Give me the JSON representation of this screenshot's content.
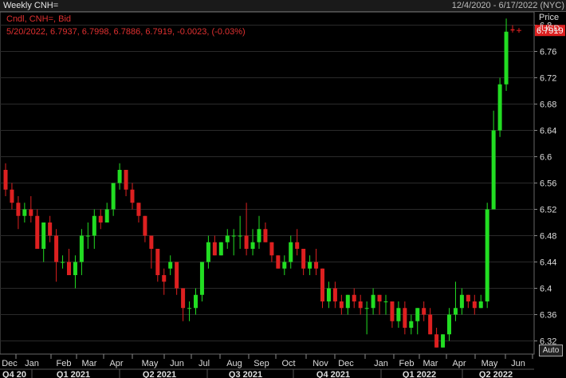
{
  "header": {
    "title": "Weekly CNH=",
    "date_range": "12/4/2020 - 6/17/2022 (NYC)"
  },
  "legend": {
    "line1": "Cndl, CNH=, Bid",
    "line2": "5/20/2022, 6.7937, 6.7998, 6.7886, 6.7919, -0.0023, (-0.03%)"
  },
  "axis": {
    "price_label_1": "Price",
    "price_label_2": "/USD",
    "last_price": "6.7919",
    "yticks": [
      6.32,
      6.36,
      6.4,
      6.44,
      6.48,
      6.52,
      6.56,
      6.6,
      6.64,
      6.68,
      6.72,
      6.76,
      6.8
    ],
    "months": [
      "Dec",
      "Jan",
      "Feb",
      "Mar",
      "Apr",
      "May",
      "Jun",
      "Jul",
      "Aug",
      "Sep",
      "Oct",
      "Nov",
      "Dec",
      "Jan",
      "Feb",
      "Mar",
      "Apr",
      "May",
      "Jun"
    ],
    "quarters": [
      "Q4 20",
      "Q1 2021",
      "Q2 2021",
      "Q3 2021",
      "Q4 2021",
      "Q1 2022",
      "Q2 2022"
    ]
  },
  "auto_label": "Auto",
  "colors": {
    "up": "#22dd22",
    "down": "#dd2020",
    "legend_text": "#e03030",
    "background": "#000000",
    "grid": "#2a2a2a"
  },
  "chart_data": {
    "type": "candlestick",
    "title": "Weekly CNH=",
    "ylabel": "Price /USD",
    "ylim": [
      6.3,
      6.82
    ],
    "x_start": "2020-12-04",
    "interval": "weekly",
    "last_close": 6.7919,
    "ohlc": [
      [
        6.58,
        6.59,
        6.54,
        6.55
      ],
      [
        6.55,
        6.56,
        6.52,
        6.53
      ],
      [
        6.53,
        6.54,
        6.49,
        6.51
      ],
      [
        6.51,
        6.53,
        6.5,
        6.52
      ],
      [
        6.52,
        6.54,
        6.5,
        6.51
      ],
      [
        6.51,
        6.52,
        6.46,
        6.46
      ],
      [
        6.46,
        6.5,
        6.44,
        6.5
      ],
      [
        6.5,
        6.51,
        6.47,
        6.48
      ],
      [
        6.48,
        6.49,
        6.41,
        6.44
      ],
      [
        6.44,
        6.45,
        6.43,
        6.44
      ],
      [
        6.44,
        6.46,
        6.42,
        6.42
      ],
      [
        6.42,
        6.45,
        6.4,
        6.44
      ],
      [
        6.44,
        6.49,
        6.42,
        6.48
      ],
      [
        6.48,
        6.5,
        6.46,
        6.48
      ],
      [
        6.48,
        6.52,
        6.46,
        6.51
      ],
      [
        6.51,
        6.52,
        6.49,
        6.5
      ],
      [
        6.5,
        6.53,
        6.5,
        6.52
      ],
      [
        6.52,
        6.56,
        6.51,
        6.56
      ],
      [
        6.56,
        6.59,
        6.55,
        6.58
      ],
      [
        6.58,
        6.58,
        6.54,
        6.55
      ],
      [
        6.55,
        6.56,
        6.52,
        6.53
      ],
      [
        6.53,
        6.53,
        6.5,
        6.51
      ],
      [
        6.51,
        6.51,
        6.47,
        6.48
      ],
      [
        6.48,
        6.48,
        6.43,
        6.46
      ],
      [
        6.46,
        6.46,
        6.41,
        6.42
      ],
      [
        6.42,
        6.43,
        6.39,
        6.41
      ],
      [
        6.43,
        6.45,
        6.42,
        6.44
      ],
      [
        6.44,
        6.44,
        6.39,
        6.4
      ],
      [
        6.4,
        6.4,
        6.35,
        6.37
      ],
      [
        6.37,
        6.38,
        6.35,
        6.37
      ],
      [
        6.37,
        6.4,
        6.36,
        6.39
      ],
      [
        6.39,
        6.44,
        6.38,
        6.44
      ],
      [
        6.44,
        6.48,
        6.43,
        6.47
      ],
      [
        6.47,
        6.48,
        6.45,
        6.45
      ],
      [
        6.45,
        6.47,
        6.45,
        6.47
      ],
      [
        6.47,
        6.49,
        6.46,
        6.48
      ],
      [
        6.48,
        6.49,
        6.45,
        6.48
      ],
      [
        6.48,
        6.51,
        6.46,
        6.48
      ],
      [
        6.48,
        6.53,
        6.45,
        6.46
      ],
      [
        6.46,
        6.49,
        6.45,
        6.47
      ],
      [
        6.47,
        6.51,
        6.46,
        6.49
      ],
      [
        6.49,
        6.5,
        6.47,
        6.47
      ],
      [
        6.47,
        6.47,
        6.44,
        6.45
      ],
      [
        6.45,
        6.45,
        6.43,
        6.43
      ],
      [
        6.43,
        6.45,
        6.42,
        6.44
      ],
      [
        6.44,
        6.48,
        6.43,
        6.47
      ],
      [
        6.47,
        6.49,
        6.45,
        6.46
      ],
      [
        6.46,
        6.46,
        6.42,
        6.43
      ],
      [
        6.43,
        6.45,
        6.42,
        6.44
      ],
      [
        6.44,
        6.46,
        6.42,
        6.43
      ],
      [
        6.43,
        6.43,
        6.37,
        6.38
      ],
      [
        6.38,
        6.41,
        6.37,
        6.4
      ],
      [
        6.4,
        6.41,
        6.37,
        6.38
      ],
      [
        6.38,
        6.39,
        6.36,
        6.37
      ],
      [
        6.37,
        6.39,
        6.36,
        6.39
      ],
      [
        6.39,
        6.4,
        6.37,
        6.38
      ],
      [
        6.38,
        6.39,
        6.36,
        6.37
      ],
      [
        6.37,
        6.38,
        6.33,
        6.37
      ],
      [
        6.37,
        6.4,
        6.36,
        6.39
      ],
      [
        6.39,
        6.39,
        6.36,
        6.38
      ],
      [
        6.38,
        6.39,
        6.36,
        6.38
      ],
      [
        6.38,
        6.38,
        6.34,
        6.35
      ],
      [
        6.35,
        6.38,
        6.34,
        6.37
      ],
      [
        6.37,
        6.38,
        6.33,
        6.34
      ],
      [
        6.34,
        6.36,
        6.33,
        6.35
      ],
      [
        6.35,
        6.37,
        6.33,
        6.37
      ],
      [
        6.37,
        6.38,
        6.35,
        6.36
      ],
      [
        6.36,
        6.37,
        6.33,
        6.33
      ],
      [
        6.33,
        6.34,
        6.31,
        6.31
      ],
      [
        6.31,
        6.33,
        6.31,
        6.33
      ],
      [
        6.33,
        6.37,
        6.32,
        6.36
      ],
      [
        6.36,
        6.41,
        6.35,
        6.37
      ],
      [
        6.37,
        6.4,
        6.36,
        6.39
      ],
      [
        6.39,
        6.39,
        6.37,
        6.38
      ],
      [
        6.38,
        6.39,
        6.36,
        6.37
      ],
      [
        6.37,
        6.39,
        6.37,
        6.38
      ],
      [
        6.38,
        6.53,
        6.37,
        6.52
      ],
      [
        6.52,
        6.67,
        6.52,
        6.64
      ],
      [
        6.64,
        6.72,
        6.63,
        6.71
      ],
      [
        6.71,
        6.81,
        6.7,
        6.79
      ],
      [
        6.7937,
        6.7998,
        6.7886,
        6.7919
      ]
    ]
  }
}
